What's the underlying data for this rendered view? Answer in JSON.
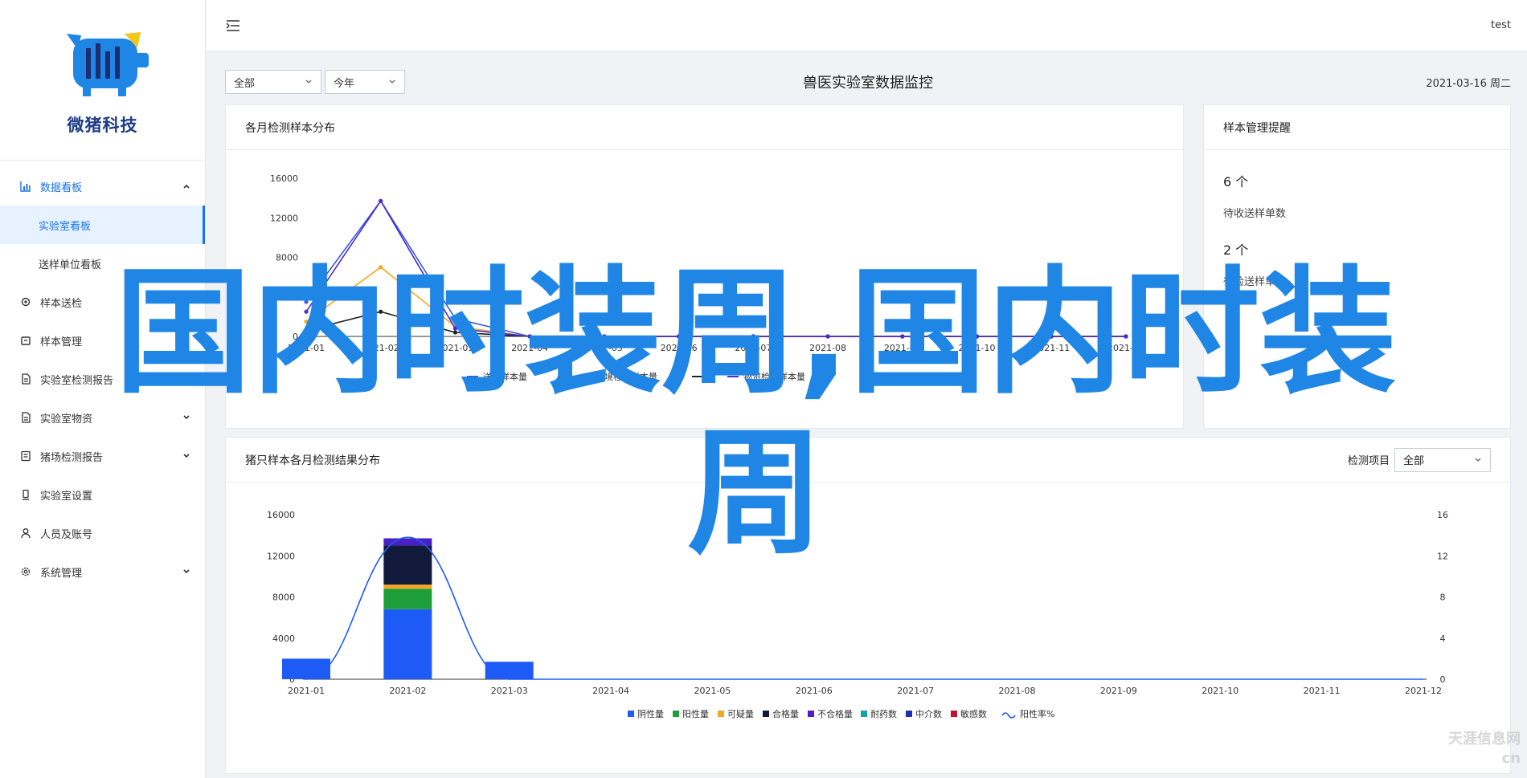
{
  "app": {
    "brand": "微猪科技",
    "user": "test"
  },
  "sidebar": {
    "items": [
      {
        "label": "数据看板",
        "icon": "bar-chart-icon",
        "expanded": true,
        "children": [
          {
            "label": "实验室看板",
            "selected": true
          },
          {
            "label": "送样单位看板",
            "selected": false
          }
        ]
      },
      {
        "label": "样本送检",
        "icon": "gear-icon"
      },
      {
        "label": "样本管理",
        "icon": "box-icon"
      },
      {
        "label": "实验室检测报告",
        "icon": "document-icon"
      },
      {
        "label": "实验室物资",
        "icon": "document-icon"
      },
      {
        "label": "猪场检测报告",
        "icon": "report-icon"
      },
      {
        "label": "实验室设置",
        "icon": "device-icon"
      },
      {
        "label": "人员及账号",
        "icon": "user-icon"
      },
      {
        "label": "系统管理",
        "icon": "gear-icon"
      }
    ]
  },
  "toolbar": {
    "range_select": "全部",
    "period_select": "今年",
    "title": "兽医实验室数据监控",
    "date": "2021-03-16 周二"
  },
  "line_card": {
    "title": "各月检测样本分布"
  },
  "remind_card": {
    "title": "样本管理提醒",
    "items": [
      {
        "count": "6 个",
        "label": "待收送样单数"
      },
      {
        "count": "2 个",
        "label": "待检送样单数"
      }
    ]
  },
  "bar_card": {
    "title": "猪只样本各月检测结果分布",
    "filter_label": "检测项目",
    "filter_value": "全部"
  },
  "overlay": {
    "line1": "国内时装周,国内时装",
    "line2": "周"
  },
  "watermark": {
    "line1": "天涯信息网",
    "line2": "cn"
  },
  "chart_data": [
    {
      "type": "line",
      "title": "各月检测样本分布",
      "x": [
        "2021-01",
        "2021-02",
        "2021-03",
        "2021-04",
        "2021-05",
        "2021-06",
        "2021-07",
        "2021-08",
        "2021-09",
        "2021-10",
        "2021-11",
        "2021-12"
      ],
      "ylim": [
        0,
        16000
      ],
      "yticks": [
        16000,
        12000,
        8000,
        4000,
        0
      ],
      "grid": false,
      "legend_position": "bottom",
      "series": [
        {
          "name": "送样样本量",
          "color": "#3b5bdb",
          "values": [
            3500,
            13700,
            1800,
            0,
            0,
            0,
            0,
            0,
            0,
            0,
            0,
            0
          ]
        },
        {
          "name": "环境检测样本量",
          "color": "#f5a623",
          "values": [
            1500,
            7000,
            1000,
            0,
            0,
            0,
            0,
            0,
            0,
            0,
            0,
            0
          ]
        },
        {
          "name": "",
          "color": "#222222",
          "values": [
            600,
            2500,
            400,
            0,
            0,
            0,
            0,
            0,
            0,
            0,
            0,
            0
          ]
        },
        {
          "name": "物资检测样本量",
          "color": "#4b2bd1",
          "values": [
            2500,
            13700,
            800,
            0,
            0,
            0,
            0,
            0,
            0,
            0,
            0,
            0
          ]
        }
      ]
    },
    {
      "type": "bar",
      "title": "猪只样本各月检测结果分布",
      "categories": [
        "2021-01",
        "2021-02",
        "2021-03",
        "2021-04",
        "2021-05",
        "2021-06",
        "2021-07",
        "2021-08",
        "2021-09",
        "2021-10",
        "2021-11",
        "2021-12"
      ],
      "ylim": [
        0,
        16000
      ],
      "yticks": [
        16000,
        12000,
        8000,
        4000,
        0
      ],
      "y2lim": [
        0,
        16
      ],
      "y2ticks": [
        16,
        12,
        8,
        4,
        0
      ],
      "stacked": true,
      "legend_position": "bottom",
      "series": [
        {
          "name": "阴性量",
          "color": "#1e5bf6",
          "values": [
            2000,
            6800,
            1700,
            0,
            0,
            0,
            0,
            0,
            0,
            0,
            0,
            0
          ]
        },
        {
          "name": "阳性量",
          "color": "#1e9e3a",
          "values": [
            0,
            2000,
            0,
            0,
            0,
            0,
            0,
            0,
            0,
            0,
            0,
            0
          ]
        },
        {
          "name": "可疑量",
          "color": "#f5a623",
          "values": [
            0,
            400,
            0,
            0,
            0,
            0,
            0,
            0,
            0,
            0,
            0,
            0
          ]
        },
        {
          "name": "合格量",
          "color": "#111a3a",
          "values": [
            0,
            3800,
            0,
            0,
            0,
            0,
            0,
            0,
            0,
            0,
            0,
            0
          ]
        },
        {
          "name": "不合格量",
          "color": "#4b1fc7",
          "values": [
            0,
            700,
            0,
            0,
            0,
            0,
            0,
            0,
            0,
            0,
            0,
            0
          ]
        },
        {
          "name": "耐药数",
          "color": "#12a3a3",
          "values": [
            0,
            0,
            0,
            0,
            0,
            0,
            0,
            0,
            0,
            0,
            0,
            0
          ]
        },
        {
          "name": "中介数",
          "color": "#1f2fb3",
          "values": [
            0,
            0,
            0,
            0,
            0,
            0,
            0,
            0,
            0,
            0,
            0,
            0
          ]
        },
        {
          "name": "敏感数",
          "color": "#c8102e",
          "values": [
            0,
            0,
            0,
            0,
            0,
            0,
            0,
            0,
            0,
            0,
            0,
            0
          ]
        }
      ],
      "line_series": {
        "name": "阳性率%",
        "color": "#1e5bf6",
        "axis": "right",
        "values": [
          0,
          13.8,
          0,
          0,
          0,
          0,
          0,
          0,
          0,
          0,
          0,
          0
        ]
      }
    }
  ]
}
